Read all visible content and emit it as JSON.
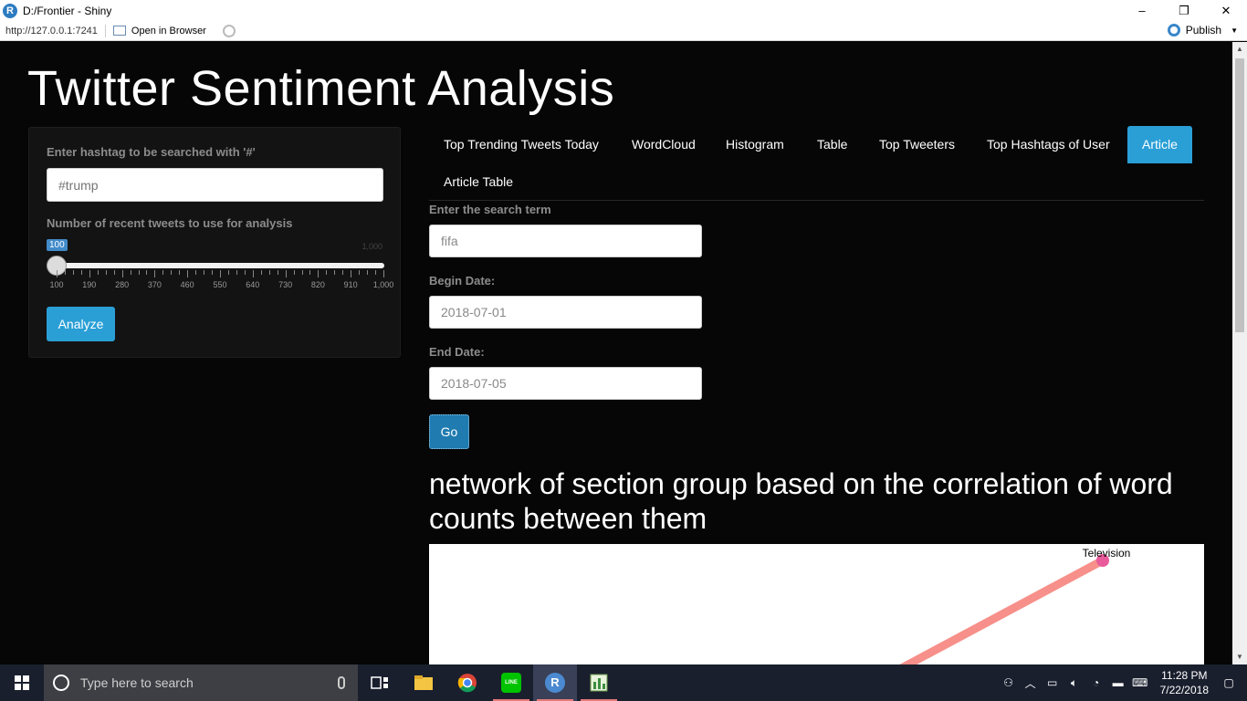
{
  "window": {
    "title": "D:/Frontier - Shiny",
    "app_icon": "R",
    "controls": [
      "–",
      "❐",
      "✕"
    ]
  },
  "toolbar": {
    "url": "http://127.0.0.1:7241",
    "open_browser": "Open in Browser",
    "publish": "Publish"
  },
  "app": {
    "title": "Twitter Sentiment Analysis"
  },
  "sidebar": {
    "hashtag_label": "Enter hashtag to be searched with '#'",
    "hashtag_placeholder": "#trump",
    "slider_label": "Number of recent tweets to use for analysis",
    "slider_value": "100",
    "slider_max_label": "1,000",
    "slider_fraction": 0,
    "slider_ticks": [
      "100",
      "190",
      "280",
      "370",
      "460",
      "550",
      "640",
      "730",
      "820",
      "910",
      "1,000"
    ],
    "analyze_button": "Analyze"
  },
  "tabs": {
    "items": [
      "Top Trending Tweets Today",
      "WordCloud",
      "Histogram",
      "Table",
      "Top Tweeters",
      "Top Hashtags of User",
      "Article",
      "Article Table"
    ],
    "active": "Article"
  },
  "article": {
    "search_label": "Enter the search term",
    "search_value": "fifa",
    "begin_label": "Begin Date:",
    "begin_value": "2018-07-01",
    "end_label": "End Date:",
    "end_value": "2018-07-05",
    "go_button": "Go",
    "network_title": "network of section group based on the correlation of word counts between them",
    "network_node_label": "Television",
    "edge_color": "#f7908a",
    "node_color": "#e85a9a"
  },
  "taskbar": {
    "search_placeholder": "Type here to search",
    "time": "11:28 PM",
    "date": "7/22/2018"
  }
}
